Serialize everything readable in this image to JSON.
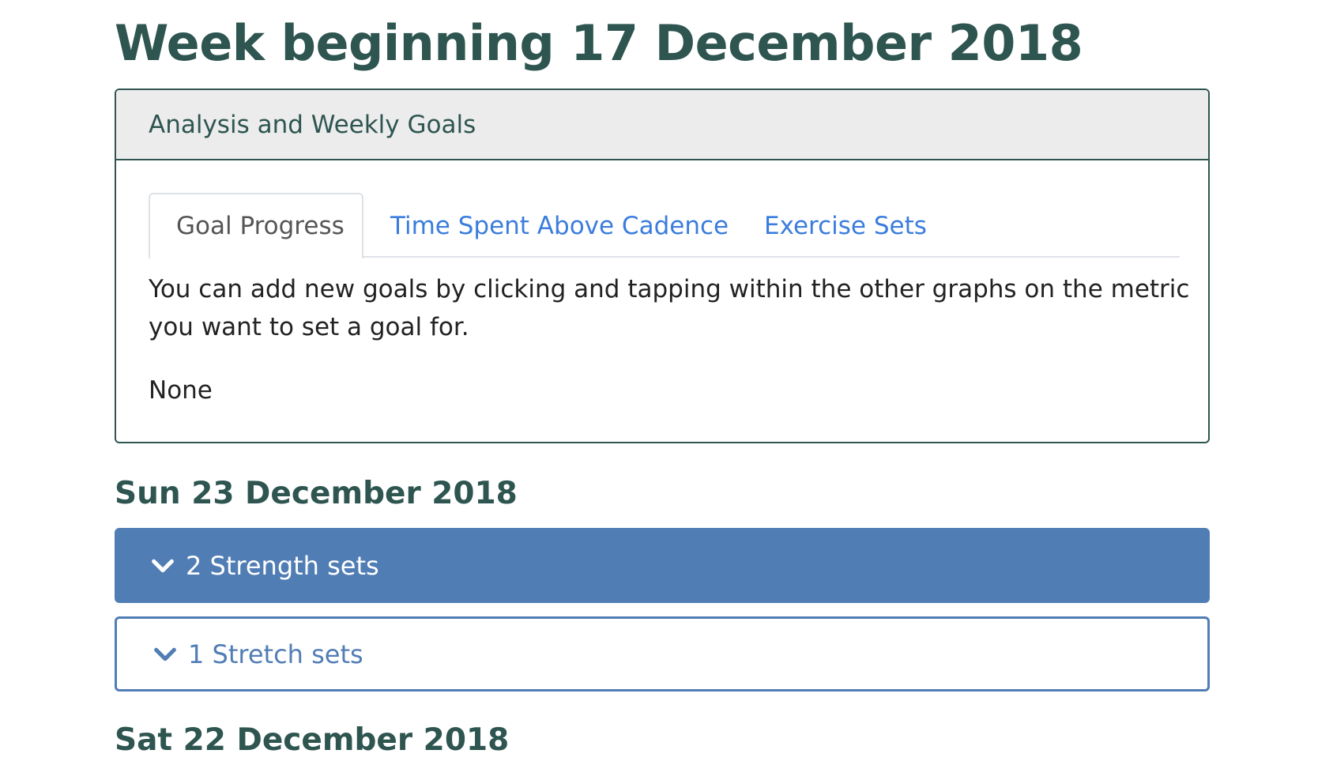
{
  "page": {
    "title": "Week beginning 17 December 2018"
  },
  "analysis_card": {
    "header": "Analysis and Weekly Goals",
    "tabs": [
      {
        "label": "Goal Progress",
        "active": true
      },
      {
        "label": "Time Spent Above Cadence",
        "active": false
      },
      {
        "label": "Exercise Sets",
        "active": false
      }
    ],
    "help_text": "You can add new goals by clicking and tapping within the other graphs on the metric you want to set a goal for.",
    "goals_value": "None"
  },
  "days": [
    {
      "label": "Sun 23 December 2018",
      "groups": [
        {
          "label": "2 Strength sets",
          "icon": "chevron-down-icon"
        },
        {
          "label": "1 Stretch sets",
          "icon": "chevron-down-icon"
        }
      ]
    },
    {
      "label": "Sat 22 December 2018"
    }
  ],
  "colors": {
    "heading": "#2e5550",
    "link": "#3b7ddd",
    "strength_bg": "#517db5",
    "header_bg": "#ececec"
  }
}
